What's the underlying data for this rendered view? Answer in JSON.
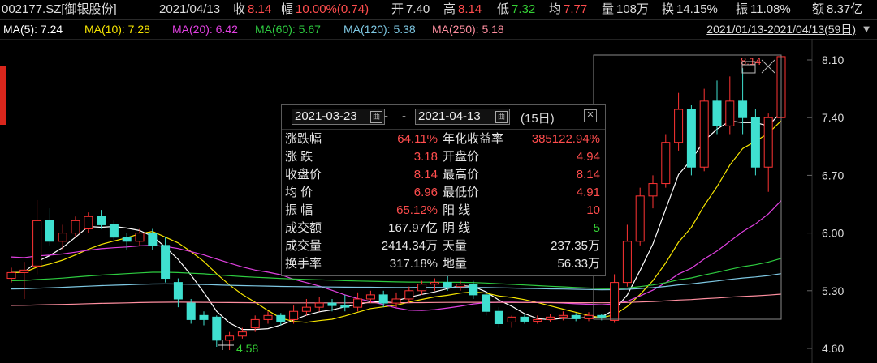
{
  "header": {
    "code": "002177.SZ[御银股份]",
    "date": "2021/04/13",
    "close_label": "收",
    "close": "8.14",
    "change_label": "幅",
    "change": "10.00%(0.74)",
    "open_label": "开",
    "open": "7.40",
    "high_label": "高",
    "high": "8.14",
    "low_label": "低",
    "low": "7.32",
    "avg_label": "均",
    "avg": "7.77",
    "vol_label": "量",
    "vol": "108万",
    "turn_label": "换",
    "turn": "14.15%",
    "amp_label": "振",
    "amp": "11.08%",
    "amt_label": "额",
    "amt": "8.37亿"
  },
  "ma": [
    {
      "text": "MA(5): 7.24",
      "color": "#ffffff"
    },
    {
      "text": "MA(10): 7.28",
      "color": "#f5e400"
    },
    {
      "text": "MA(20): 6.42",
      "color": "#e040e0"
    },
    {
      "text": "MA(60): 5.67",
      "color": "#2ecc40"
    },
    {
      "text": "MA(120): 5.38",
      "color": "#7ec8e3"
    },
    {
      "text": "MA(250): 5.18",
      "color": "#ff8fa0"
    }
  ],
  "range_label": "2021/01/13-2021/04/13(59日)",
  "panel": {
    "start_date": "2021-03-23",
    "dash": "-",
    "end_date": "2021-04-13",
    "days": "(15日)",
    "rows": [
      {
        "l1": "涨跌幅",
        "v1": "64.11%",
        "c1": "red",
        "l2": "年化收益率",
        "v2": "385122.94%",
        "c2": "red"
      },
      {
        "l1": "涨  跌",
        "v1": "3.18",
        "c1": "red",
        "l2": "开盘价",
        "v2": "4.94",
        "c2": "red"
      },
      {
        "l1": "收盘价",
        "v1": "8.14",
        "c1": "red",
        "l2": "最高价",
        "v2": "8.14",
        "c2": "red"
      },
      {
        "l1": "均  价",
        "v1": "6.96",
        "c1": "red",
        "l2": "最低价",
        "v2": "4.91",
        "c2": "red"
      },
      {
        "l1": "振  幅",
        "v1": "65.12%",
        "c1": "red",
        "l2": "阳  线",
        "v2": "10",
        "c2": "red"
      },
      {
        "l1": "成交额",
        "v1": "167.97亿",
        "c1": "wht",
        "l2": "阴  线",
        "v2": "5",
        "c2": "grn"
      },
      {
        "l1": "成交量",
        "v1": "2414.34万",
        "c1": "wht",
        "l2": "天量",
        "v2": "237.35万",
        "c2": "wht"
      },
      {
        "l1": "换手率",
        "v1": "317.18%",
        "c1": "wht",
        "l2": "地量",
        "v2": "56.33万",
        "c2": "wht"
      }
    ]
  },
  "chart_data": {
    "type": "candlestick",
    "y_ticks": [
      "8.10",
      "7.40",
      "6.70",
      "6.00",
      "5.30",
      "4.60"
    ],
    "ylim": [
      4.55,
      8.2
    ],
    "low_marker": "4.58",
    "high_marker": "8.14",
    "up_color": "#ff3333",
    "down_color": "#3fe0d0",
    "candles": [
      [
        5.45,
        5.52,
        5.4,
        5.58
      ],
      [
        5.52,
        5.55,
        5.2,
        5.65
      ],
      [
        5.6,
        6.15,
        5.5,
        6.4
      ],
      [
        6.15,
        5.9,
        5.85,
        6.3
      ],
      [
        5.9,
        6.0,
        5.8,
        6.1
      ],
      [
        6.0,
        6.15,
        5.95,
        6.2
      ],
      [
        6.05,
        6.2,
        6.0,
        6.25
      ],
      [
        6.2,
        6.1,
        6.05,
        6.28
      ],
      [
        6.1,
        5.95,
        5.9,
        6.15
      ],
      [
        5.95,
        5.9,
        5.8,
        6.0
      ],
      [
        5.9,
        6.0,
        5.85,
        6.05
      ],
      [
        6.0,
        5.85,
        5.8,
        6.05
      ],
      [
        5.85,
        5.45,
        5.4,
        5.95
      ],
      [
        5.4,
        5.2,
        5.1,
        5.45
      ],
      [
        5.15,
        4.95,
        4.9,
        5.2
      ],
      [
        5.0,
        4.95,
        4.88,
        5.05
      ],
      [
        4.98,
        4.7,
        4.62,
        5.0
      ],
      [
        4.7,
        4.75,
        4.58,
        4.8
      ],
      [
        4.75,
        4.8,
        4.72,
        4.85
      ],
      [
        4.85,
        4.95,
        4.8,
        5.0
      ],
      [
        4.95,
        5.0,
        4.9,
        5.05
      ],
      [
        5.0,
        4.92,
        4.88,
        5.03
      ],
      [
        4.95,
        5.05,
        4.9,
        5.12
      ],
      [
        5.05,
        5.1,
        5.0,
        5.2
      ],
      [
        5.1,
        5.15,
        5.05,
        5.22
      ],
      [
        5.15,
        5.12,
        5.05,
        5.2
      ],
      [
        5.12,
        5.1,
        5.05,
        5.25
      ],
      [
        5.1,
        5.2,
        5.05,
        5.28
      ],
      [
        5.2,
        5.25,
        5.15,
        5.3
      ],
      [
        5.25,
        5.15,
        5.1,
        5.3
      ],
      [
        5.15,
        5.2,
        5.1,
        5.28
      ],
      [
        5.2,
        5.3,
        5.15,
        5.35
      ],
      [
        5.3,
        5.38,
        5.25,
        5.42
      ],
      [
        5.38,
        5.4,
        5.3,
        5.45
      ],
      [
        5.4,
        5.35,
        5.3,
        5.48
      ],
      [
        5.35,
        5.38,
        5.3,
        5.42
      ],
      [
        5.38,
        5.25,
        5.2,
        5.42
      ],
      [
        5.25,
        5.05,
        5.0,
        5.3
      ],
      [
        5.05,
        4.9,
        4.85,
        5.1
      ],
      [
        4.92,
        4.98,
        4.85,
        5.0
      ],
      [
        4.98,
        4.93,
        4.9,
        5.02
      ],
      [
        4.93,
        4.95,
        4.9,
        5.0
      ],
      [
        4.95,
        4.98,
        4.92,
        5.02
      ],
      [
        4.98,
        5.0,
        4.94,
        5.05
      ],
      [
        5.0,
        4.96,
        4.93,
        5.03
      ],
      [
        4.96,
        5.0,
        4.93,
        5.04
      ],
      [
        5.0,
        4.98,
        4.94,
        5.02
      ],
      [
        4.94,
        5.4,
        4.91,
        5.5
      ],
      [
        5.4,
        5.9,
        5.35,
        6.1
      ],
      [
        5.9,
        6.45,
        5.85,
        6.55
      ],
      [
        6.45,
        6.6,
        6.3,
        6.7
      ],
      [
        6.6,
        7.1,
        6.55,
        7.2
      ],
      [
        7.1,
        7.5,
        7.0,
        7.7
      ],
      [
        7.5,
        6.8,
        6.7,
        7.55
      ],
      [
        6.8,
        7.6,
        6.75,
        7.75
      ],
      [
        7.6,
        7.3,
        7.2,
        7.85
      ],
      [
        7.3,
        7.6,
        7.2,
        7.9
      ],
      [
        7.6,
        7.4,
        7.2,
        8.0
      ],
      [
        7.4,
        6.8,
        6.7,
        7.5
      ],
      [
        6.8,
        7.4,
        6.5,
        7.45
      ],
      [
        7.4,
        8.14,
        7.32,
        8.14
      ]
    ]
  }
}
